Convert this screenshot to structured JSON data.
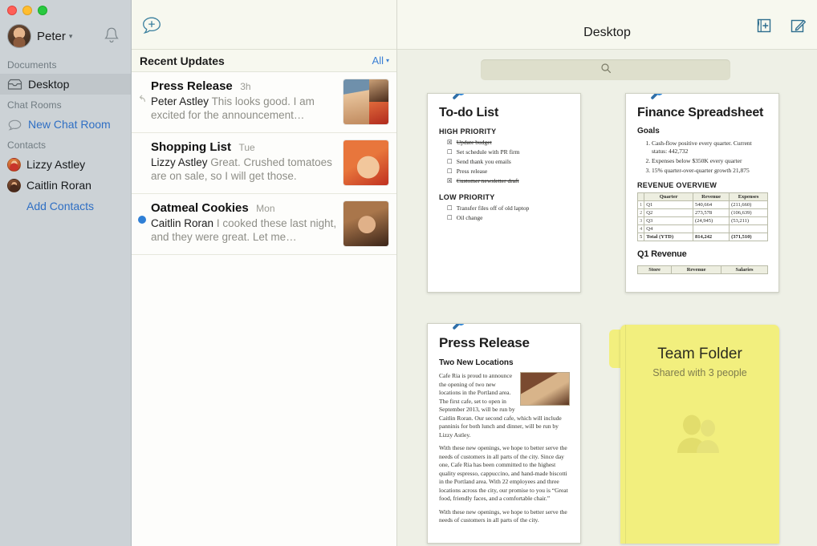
{
  "window": {
    "traffic_lights": [
      "close",
      "minimize",
      "zoom"
    ],
    "colors": {
      "close": "#ff5f57",
      "minimize": "#ffbd2e",
      "zoom": "#28c940",
      "accent_blue": "#2f6fc4",
      "toolbar_icon": "#2e6e8e",
      "desktop_bg": "#eef0e6",
      "sidebar_bg": "#ccd2d6",
      "folder_yellow": "#f2ef7e",
      "pin_blue": "#2f86d6"
    }
  },
  "sidebar": {
    "user": {
      "name": "Peter",
      "chevron": "▾",
      "avatar": "avatar-peter"
    },
    "notifications_icon": "bell-icon",
    "sections": [
      {
        "label": "Documents",
        "items": [
          {
            "label": "Desktop",
            "icon": "inbox-icon",
            "selected": true
          }
        ]
      },
      {
        "label": "Chat Rooms",
        "items": [
          {
            "label": "New Chat Room",
            "icon": "chat-bubble-icon",
            "link": true
          }
        ]
      },
      {
        "label": "Contacts",
        "items": [
          {
            "label": "Lizzy Astley",
            "icon": "avatar-lizzy"
          },
          {
            "label": "Caitlin Roran",
            "icon": "avatar-caitlin"
          },
          {
            "label": "Add Contacts",
            "link": true
          }
        ]
      }
    ]
  },
  "list_panel": {
    "header": "Recent Updates",
    "filter_label": "All",
    "filter_chevron": "▾",
    "updates": [
      {
        "title": "Press Release",
        "time": "3h",
        "sender": "Peter Astley",
        "message": "This looks good. I am excited for the announcement…",
        "mark": "reply-icon",
        "unread": false,
        "thumb": "composite-3-photos"
      },
      {
        "title": "Shopping List",
        "time": "Tue",
        "sender": "Lizzy Astley",
        "message": "Great. Crushed tomatoes are on sale, so I will get those.",
        "mark": "none",
        "unread": false,
        "thumb": "photo-lizzy"
      },
      {
        "title": "Oatmeal Cookies",
        "time": "Mon",
        "sender": "Caitlin Roran",
        "message": "I cooked these last night, and they were great. Let me…",
        "mark": "unread-dot",
        "unread": true,
        "thumb": "photo-caitlin"
      }
    ]
  },
  "toolbar": {
    "new_message_icon": "new-message-bubble-plus-icon",
    "title": "Desktop",
    "add_folder_icon": "add-folder-icon",
    "compose_icon": "compose-pencil-icon"
  },
  "search": {
    "value": "",
    "placeholder": "",
    "icon": "search-icon"
  },
  "cards": {
    "todo": {
      "pin": "pin-icon",
      "title": "To-do List",
      "sections": [
        {
          "label": "HIGH PRIORITY",
          "items": [
            {
              "text": "Update budget",
              "checked": true
            },
            {
              "text": "Set schedule with PR firm",
              "checked": false
            },
            {
              "text": "Send thank you emails",
              "checked": false
            },
            {
              "text": "Press release",
              "checked": false
            },
            {
              "text": "Customer newsletter draft",
              "checked": true
            }
          ]
        },
        {
          "label": "LOW PRIORITY",
          "items": [
            {
              "text": "Transfer files off of old laptop",
              "checked": false
            },
            {
              "text": "Oil change",
              "checked": false
            }
          ]
        }
      ]
    },
    "finance": {
      "pin": "pin-icon",
      "title": "Finance Spreadsheet",
      "goals_label": "Goals",
      "goals": [
        "Cash-flow positive every quarter. Current status: 442,732",
        "Expenses below $350K every quarter",
        "15% quarter-over-quarter growth 21,875"
      ],
      "table_label": "REVENUE OVERVIEW",
      "table": {
        "columns": [
          "",
          "Quarter",
          "Revenue",
          "Expenses"
        ],
        "rows": [
          [
            "1",
            "Q1",
            "540,664",
            "(211,660)"
          ],
          [
            "2",
            "Q2",
            "273,578",
            "(106,639)"
          ],
          [
            "3",
            "Q3",
            "(24,945)",
            "(53,211)"
          ],
          [
            "4",
            "Q4",
            "",
            ""
          ],
          [
            "5",
            "Total (YTD)",
            "814,242",
            "(371,510)"
          ]
        ]
      },
      "subtable_label": "Q1 Revenue",
      "subtable_columns": [
        "Store",
        "Revenue",
        "Salaries"
      ]
    },
    "press_release": {
      "pin": "pin-icon",
      "title": "Press Release",
      "subtitle": "Two New Locations",
      "image": "cafe-photo",
      "paragraphs": [
        "Cafe Ria is proud to announce the opening of two new locations in the Portland area. The first cafe, set to open in September 2013, will be run by Caitlin Roran. Our second cafe, which will include panninis for both lunch and dinner, will be run by Lizzy Astley.",
        "With these new openings, we hope to better serve the needs of customers in all parts of the city. Since day one, Cafe Ria has been committed to the highest quality espresso, cappuccino, and hand-made biscotti in the Portland area. With 22 employees and three locations across the city, our promise to you is “Great food, friendly faces, and a comfortable chair.”",
        "With these new openings, we hope to better serve the needs of customers in all parts of the city."
      ]
    },
    "team_folder": {
      "title": "Team Folder",
      "subtitle": "Shared with 3 people",
      "icon": "people-icon"
    }
  }
}
